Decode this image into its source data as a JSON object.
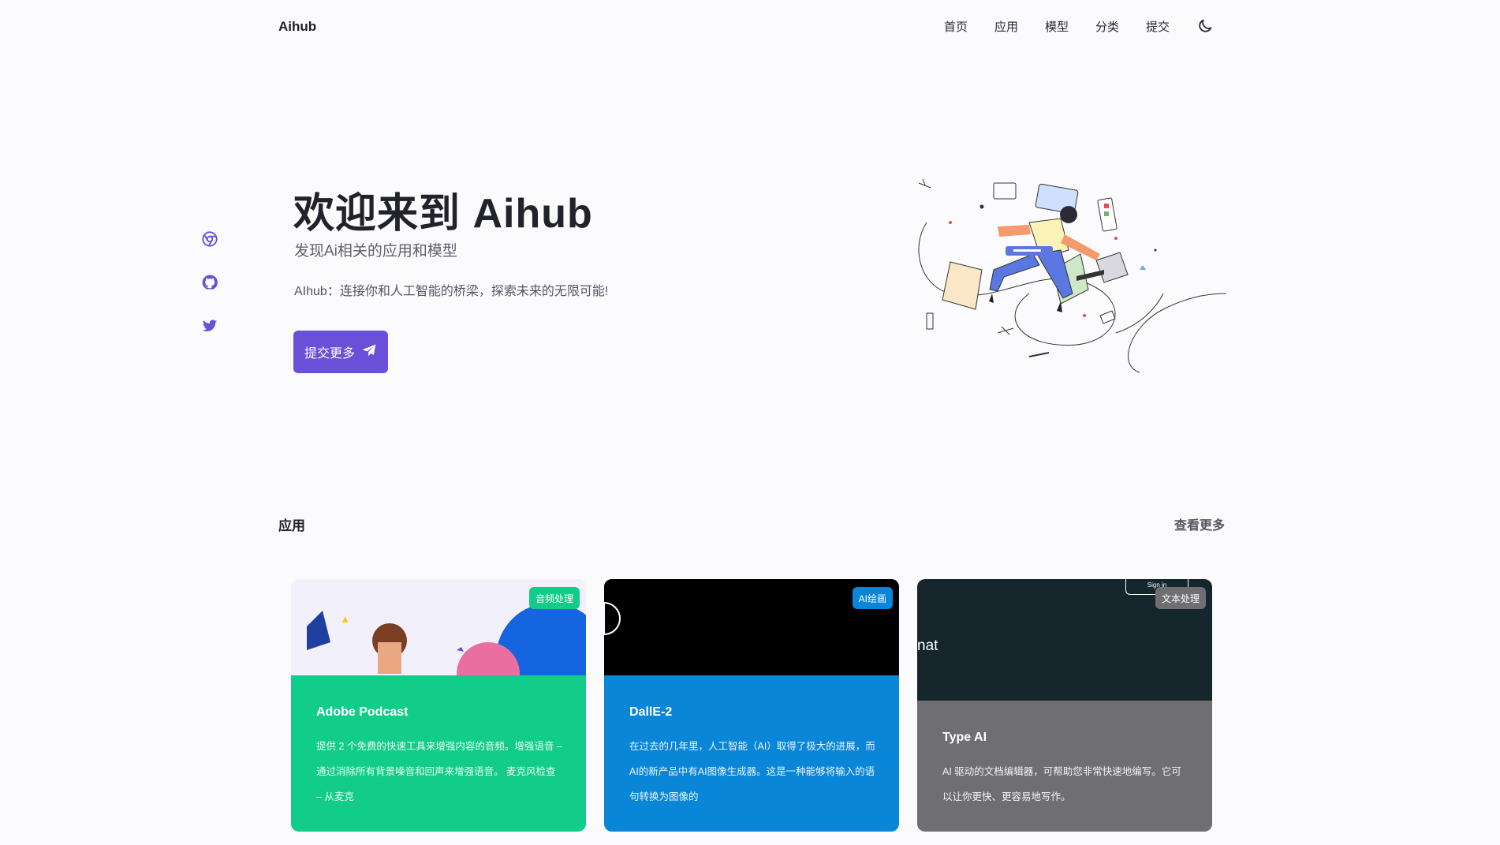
{
  "header": {
    "logo": "Aihub",
    "nav": [
      "首页",
      "应用",
      "模型",
      "分类",
      "提交"
    ],
    "theme_icon": "moon-icon"
  },
  "social": [
    "chrome-icon",
    "github-icon",
    "twitter-icon"
  ],
  "hero": {
    "title": "欢迎来到 Aihub",
    "subtitle": "发现Ai相关的应用和模型",
    "description": "AIhub：连接你和人工智能的桥梁，探索未来的无限可能!",
    "cta_label": "提交更多",
    "cta_icon": "paper-plane-icon"
  },
  "section": {
    "title": "应用",
    "more": "查看更多"
  },
  "cards": [
    {
      "name": "Adobe Podcast",
      "tag": "音频处理",
      "description": "提供 2 个免费的快速工具来增强内容的音频。增强语音 – 通过消除所有背景噪音和回声来增强语音。 麦克风检查 – 从麦克",
      "colors": {
        "body": "#12cc8a",
        "tag": "#12cc8a"
      }
    },
    {
      "name": "DallE-2",
      "tag": "AI绘画",
      "description": "在过去的几年里，人工智能（AI）取得了极大的进展，而AI的新产品中有AI图像生成器。这是一种能够将输入的语句转换为图像的",
      "colors": {
        "body": "#0a86d8",
        "tag": "#0a86d8"
      }
    },
    {
      "name": "Type AI",
      "tag": "文本处理",
      "thumb_text": "nat",
      "thumb_button": "Sign in",
      "description": "AI 驱动的文档编辑器，可帮助您非常快速地编写。它可以让你更快、更容易地写作。",
      "colors": {
        "body": "#6f6f72",
        "tag": "#6f6f72"
      }
    }
  ],
  "colors": {
    "accent": "#6a4fd8",
    "background": "#fbfbfd"
  }
}
